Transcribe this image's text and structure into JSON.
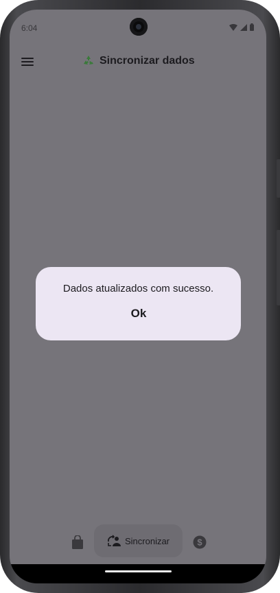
{
  "status_bar": {
    "time": "6:04"
  },
  "app_bar": {
    "title": "Sincronizar dados",
    "title_emoji": "♻️",
    "menu_icon": "menu-icon"
  },
  "dialog": {
    "message": "Dados atualizados com sucesso.",
    "ok_label": "Ok"
  },
  "bottom_nav": {
    "items": [
      {
        "icon": "shopping-bag-icon",
        "label": ""
      },
      {
        "icon": "sync-user-icon",
        "label": "Sincronizar",
        "selected": true
      },
      {
        "icon": "dollar-coin-icon",
        "label": ""
      }
    ]
  },
  "colors": {
    "scrim": "#76747a",
    "dialog_bg": "#ece6f3",
    "text": "#1c1b1f"
  }
}
